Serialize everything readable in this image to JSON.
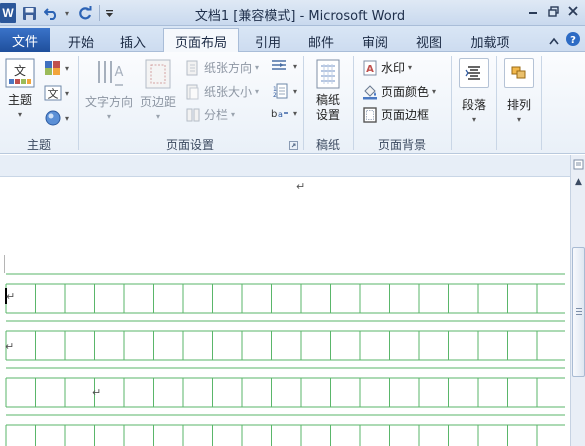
{
  "window": {
    "title": "文档1 [兼容模式] - Microsoft Word",
    "app_letter": "W"
  },
  "ribbon_tabs": {
    "file": "文件",
    "items": [
      "开始",
      "插入",
      "页面布局",
      "引用",
      "邮件",
      "审阅",
      "视图",
      "加载项"
    ],
    "active": "页面布局"
  },
  "groups": {
    "theme": {
      "label": "主题",
      "theme_button": "主题",
      "colors_icon": "theme-colors-icon",
      "fonts_icon": "theme-fonts-icon",
      "effects_icon": "theme-effects-icon"
    },
    "page_setup": {
      "label": "页面设置",
      "text_direction": "文字方向",
      "margins": "页边距",
      "orientation": "纸张方向",
      "size": "纸张大小",
      "columns": "分栏",
      "breaks_icon": "breaks-icon",
      "line_numbers_icon": "line-numbers-icon",
      "hyphenation_icon": "hyphenation-icon"
    },
    "manuscript": {
      "label": "稿纸",
      "manuscript_settings": "稿纸\n设置"
    },
    "page_background": {
      "label": "页面背景",
      "watermark": "水印",
      "page_color": "页面颜色",
      "page_borders": "页面边框"
    },
    "paragraph": {
      "label": "段落"
    },
    "arrange": {
      "label": "排列"
    }
  },
  "colors": {
    "file_tab": "#2b579a",
    "grid_line": "#5ab66a",
    "ribbon_bg": "#f3f7fc"
  }
}
